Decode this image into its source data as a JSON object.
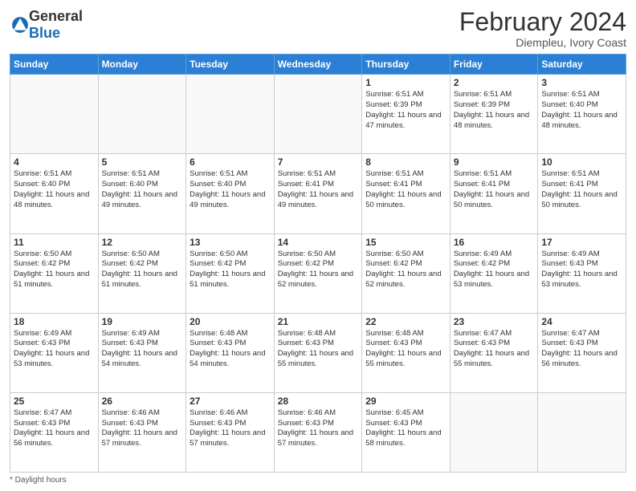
{
  "header": {
    "logo_general": "General",
    "logo_blue": "Blue",
    "title": "February 2024",
    "location": "Diempleu, Ivory Coast"
  },
  "days_of_week": [
    "Sunday",
    "Monday",
    "Tuesday",
    "Wednesday",
    "Thursday",
    "Friday",
    "Saturday"
  ],
  "weeks": [
    [
      {
        "day": "",
        "info": ""
      },
      {
        "day": "",
        "info": ""
      },
      {
        "day": "",
        "info": ""
      },
      {
        "day": "",
        "info": ""
      },
      {
        "day": "1",
        "info": "Sunrise: 6:51 AM\nSunset: 6:39 PM\nDaylight: 11 hours and 47 minutes."
      },
      {
        "day": "2",
        "info": "Sunrise: 6:51 AM\nSunset: 6:39 PM\nDaylight: 11 hours and 48 minutes."
      },
      {
        "day": "3",
        "info": "Sunrise: 6:51 AM\nSunset: 6:40 PM\nDaylight: 11 hours and 48 minutes."
      }
    ],
    [
      {
        "day": "4",
        "info": "Sunrise: 6:51 AM\nSunset: 6:40 PM\nDaylight: 11 hours and 48 minutes."
      },
      {
        "day": "5",
        "info": "Sunrise: 6:51 AM\nSunset: 6:40 PM\nDaylight: 11 hours and 49 minutes."
      },
      {
        "day": "6",
        "info": "Sunrise: 6:51 AM\nSunset: 6:40 PM\nDaylight: 11 hours and 49 minutes."
      },
      {
        "day": "7",
        "info": "Sunrise: 6:51 AM\nSunset: 6:41 PM\nDaylight: 11 hours and 49 minutes."
      },
      {
        "day": "8",
        "info": "Sunrise: 6:51 AM\nSunset: 6:41 PM\nDaylight: 11 hours and 50 minutes."
      },
      {
        "day": "9",
        "info": "Sunrise: 6:51 AM\nSunset: 6:41 PM\nDaylight: 11 hours and 50 minutes."
      },
      {
        "day": "10",
        "info": "Sunrise: 6:51 AM\nSunset: 6:41 PM\nDaylight: 11 hours and 50 minutes."
      }
    ],
    [
      {
        "day": "11",
        "info": "Sunrise: 6:50 AM\nSunset: 6:42 PM\nDaylight: 11 hours and 51 minutes."
      },
      {
        "day": "12",
        "info": "Sunrise: 6:50 AM\nSunset: 6:42 PM\nDaylight: 11 hours and 51 minutes."
      },
      {
        "day": "13",
        "info": "Sunrise: 6:50 AM\nSunset: 6:42 PM\nDaylight: 11 hours and 51 minutes."
      },
      {
        "day": "14",
        "info": "Sunrise: 6:50 AM\nSunset: 6:42 PM\nDaylight: 11 hours and 52 minutes."
      },
      {
        "day": "15",
        "info": "Sunrise: 6:50 AM\nSunset: 6:42 PM\nDaylight: 11 hours and 52 minutes."
      },
      {
        "day": "16",
        "info": "Sunrise: 6:49 AM\nSunset: 6:42 PM\nDaylight: 11 hours and 53 minutes."
      },
      {
        "day": "17",
        "info": "Sunrise: 6:49 AM\nSunset: 6:43 PM\nDaylight: 11 hours and 53 minutes."
      }
    ],
    [
      {
        "day": "18",
        "info": "Sunrise: 6:49 AM\nSunset: 6:43 PM\nDaylight: 11 hours and 53 minutes."
      },
      {
        "day": "19",
        "info": "Sunrise: 6:49 AM\nSunset: 6:43 PM\nDaylight: 11 hours and 54 minutes."
      },
      {
        "day": "20",
        "info": "Sunrise: 6:48 AM\nSunset: 6:43 PM\nDaylight: 11 hours and 54 minutes."
      },
      {
        "day": "21",
        "info": "Sunrise: 6:48 AM\nSunset: 6:43 PM\nDaylight: 11 hours and 55 minutes."
      },
      {
        "day": "22",
        "info": "Sunrise: 6:48 AM\nSunset: 6:43 PM\nDaylight: 11 hours and 55 minutes."
      },
      {
        "day": "23",
        "info": "Sunrise: 6:47 AM\nSunset: 6:43 PM\nDaylight: 11 hours and 55 minutes."
      },
      {
        "day": "24",
        "info": "Sunrise: 6:47 AM\nSunset: 6:43 PM\nDaylight: 11 hours and 56 minutes."
      }
    ],
    [
      {
        "day": "25",
        "info": "Sunrise: 6:47 AM\nSunset: 6:43 PM\nDaylight: 11 hours and 56 minutes."
      },
      {
        "day": "26",
        "info": "Sunrise: 6:46 AM\nSunset: 6:43 PM\nDaylight: 11 hours and 57 minutes."
      },
      {
        "day": "27",
        "info": "Sunrise: 6:46 AM\nSunset: 6:43 PM\nDaylight: 11 hours and 57 minutes."
      },
      {
        "day": "28",
        "info": "Sunrise: 6:46 AM\nSunset: 6:43 PM\nDaylight: 11 hours and 57 minutes."
      },
      {
        "day": "29",
        "info": "Sunrise: 6:45 AM\nSunset: 6:43 PM\nDaylight: 11 hours and 58 minutes."
      },
      {
        "day": "",
        "info": ""
      },
      {
        "day": "",
        "info": ""
      }
    ]
  ],
  "footer": {
    "note": "Daylight hours"
  }
}
